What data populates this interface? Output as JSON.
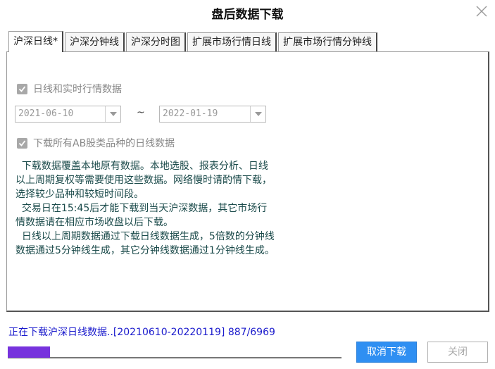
{
  "window": {
    "title": "盘后数据下载",
    "close_icon": "close-icon"
  },
  "tabs": [
    {
      "label": "沪深日线*",
      "active": true
    },
    {
      "label": "沪深分钟线",
      "active": false
    },
    {
      "label": "沪深分时图",
      "active": false
    },
    {
      "label": "扩展市场行情日线",
      "active": false
    },
    {
      "label": "扩展市场行情分钟线",
      "active": false
    }
  ],
  "panel": {
    "daily_check": {
      "label": "日线和实时行情数据",
      "checked": true,
      "enabled": false
    },
    "start_date": "2021-06-10",
    "date_separator": "~",
    "end_date": "2022-01-19",
    "ab_check": {
      "label": "下载所有AB股类品种的日线数据",
      "checked": true,
      "enabled": false
    },
    "description": [
      "  下载数据覆盖本地原有数据。本地选股、报表分析、日线以上周期复权等需要使用这些数据。网络慢时请酌情下载，选择较少品种和较短时间段。",
      "  交易日在15:45后才能下载到当天沪深数据，其它市场行情数据请在相应市场收盘以后下载。",
      "  日线以上周期数据通过下载日线数据生成，5倍数的分钟线数据通过5分钟线生成，其它分钟线数据通过1分钟线生成。"
    ]
  },
  "status": {
    "text": "正在下载沪深日线数据..[20210610-20220119] 887/6969",
    "progress_fraction": 0.1273
  },
  "buttons": {
    "cancel_label": "取消下载",
    "close_label": "关闭"
  },
  "colors": {
    "status_text": "#1a1acc",
    "progress_fill": "#7733dd",
    "primary_button": "#2f8ff2"
  }
}
